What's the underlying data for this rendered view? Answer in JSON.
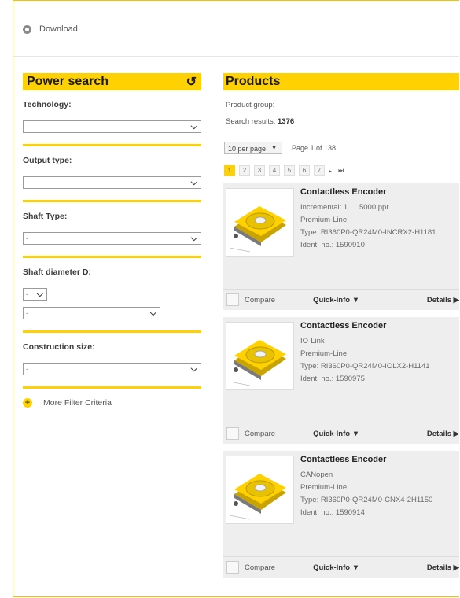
{
  "toolbar": {
    "download_label": "Download"
  },
  "power_search": {
    "title": "Power search",
    "filters": [
      {
        "label": "Technology:",
        "value": "-"
      },
      {
        "label": "Output type:",
        "value": "-"
      },
      {
        "label": "Shaft Type:",
        "value": "-"
      },
      {
        "label": "Shaft diameter D:",
        "unit_value": "-",
        "value": "-"
      },
      {
        "label": "Construction size:",
        "value": "-"
      }
    ],
    "more_label": "More Filter Criteria"
  },
  "products": {
    "title": "Products",
    "group_label": "Product group:",
    "results_label": "Search results:",
    "results_count": "1376",
    "per_page": "10 per page",
    "page_info": "Page 1 of 138",
    "pages": [
      "1",
      "2",
      "3",
      "4",
      "5",
      "6",
      "7"
    ],
    "next_symbol": "▸",
    "last_symbol": "⏭",
    "items": [
      {
        "name": "Contactless Encoder",
        "line1": "Incremental: 1 … 5000 ppr",
        "line2": "Premium-Line",
        "type": "Type: RI360P0-QR24M0-INCRX2-H1181",
        "ident": "Ident. no.: 1590910"
      },
      {
        "name": "Contactless Encoder",
        "line1": "IO-Link",
        "line2": "Premium-Line",
        "type": "Type: RI360P0-QR24M0-IOLX2-H1141",
        "ident": "Ident. no.: 1590975"
      },
      {
        "name": "Contactless Encoder",
        "line1": "CANopen",
        "line2": "Premium-Line",
        "type": "Type: RI360P0-QR24M0-CNX4-2H1150",
        "ident": "Ident. no.: 1590914"
      }
    ],
    "compare_label": "Compare",
    "quickinfo_label": "Quick-Info ▼",
    "details_label": "Details ▶"
  },
  "colors": {
    "accent": "#ffd100",
    "border": "#f0c400"
  }
}
